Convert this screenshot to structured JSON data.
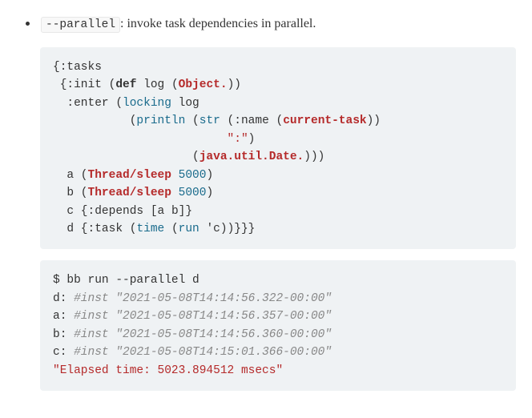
{
  "bullet": {
    "option_code": "--parallel",
    "description_suffix": ": invoke task dependencies in parallel."
  },
  "code1": {
    "l1": {
      "a": "{",
      "b": ":tasks"
    },
    "l2": {
      "a": " {",
      "b": ":init",
      "c": " (",
      "d": "def",
      "e": " log (",
      "f": "Object.",
      "g": "))"
    },
    "l3": {
      "a": "  ",
      "b": ":enter",
      "c": " (",
      "d": "locking",
      "e": " log"
    },
    "l4": {
      "a": "           (",
      "b": "println",
      "c": " (",
      "d": "str",
      "e": " (",
      "f": ":name",
      "g": " (",
      "h": "current-task",
      "i": "))"
    },
    "l5": {
      "a": "                         ",
      "b": "\":\"",
      "c": ")"
    },
    "l6": {
      "a": "                    (",
      "b": "java.util.Date.",
      "c": ")))"
    },
    "l7": {
      "a": "  a (",
      "b": "Thread/sleep",
      "c": " ",
      "d": "5000",
      "e": ")"
    },
    "l8": {
      "a": "  b (",
      "b": "Thread/sleep",
      "c": " ",
      "d": "5000",
      "e": ")"
    },
    "l9": {
      "a": "  c {",
      "b": ":depends",
      "c": " [a b]}"
    },
    "l10": {
      "a": "  d {",
      "b": ":task",
      "c": " (",
      "d": "time",
      "e": " (",
      "f": "run",
      "g": " ",
      "h": "'c",
      "i": "))}}}"
    }
  },
  "code2": {
    "l1": {
      "a": "$ bb run --parallel d"
    },
    "l2": {
      "a": "d: ",
      "b": "#inst \"2021-05-08T14:14:56.322-00:00\""
    },
    "l3": {
      "a": "a: ",
      "b": "#inst \"2021-05-08T14:14:56.357-00:00\""
    },
    "l4": {
      "a": "b: ",
      "b": "#inst \"2021-05-08T14:14:56.360-00:00\""
    },
    "l5": {
      "a": "c: ",
      "b": "#inst \"2021-05-08T14:15:01.366-00:00\""
    },
    "l6": {
      "a": "\"Elapsed time: 5023.894512 msecs\""
    }
  }
}
